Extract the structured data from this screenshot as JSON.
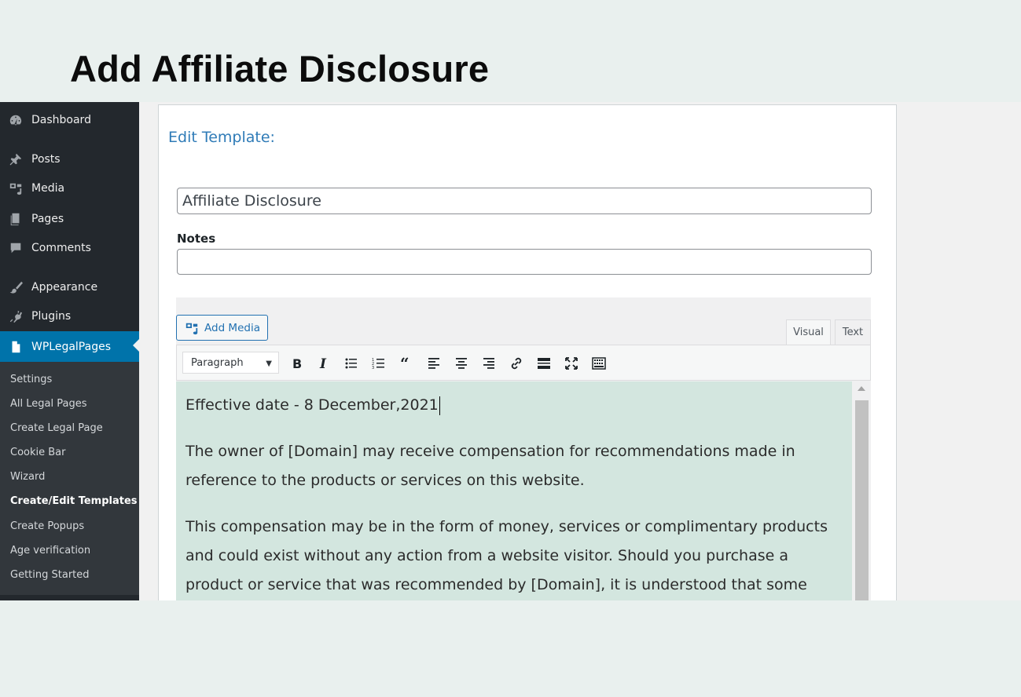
{
  "headline": "Add Affiliate Disclosure",
  "sidebar": {
    "items": [
      {
        "label": "Dashboard",
        "icon": "dashboard-icon"
      },
      {
        "label": "Posts",
        "icon": "pin-icon"
      },
      {
        "label": "Media",
        "icon": "media-icon"
      },
      {
        "label": "Pages",
        "icon": "pages-icon"
      },
      {
        "label": "Comments",
        "icon": "comments-icon"
      },
      {
        "label": "Appearance",
        "icon": "brush-icon"
      },
      {
        "label": "Plugins",
        "icon": "plug-icon"
      },
      {
        "label": "WPLegalPages",
        "icon": "document-icon"
      }
    ],
    "submenu": [
      "Settings",
      "All Legal Pages",
      "Create Legal Page",
      "Cookie Bar",
      "Wizard",
      "Create/Edit Templates",
      "Create Popups",
      "Age verification",
      "Getting Started"
    ],
    "current_submenu": "Create/Edit Templates"
  },
  "editor": {
    "heading": "Edit Template:",
    "title_value": "Affiliate Disclosure",
    "notes_label": "Notes",
    "notes_value": "",
    "add_media_label": "Add Media",
    "tab_visual": "Visual",
    "tab_text": "Text",
    "format_select": "Paragraph",
    "toolbar_icons": [
      "bold-icon",
      "italic-icon",
      "bullet-list-icon",
      "numbered-list-icon",
      "blockquote-icon",
      "align-left-icon",
      "align-center-icon",
      "align-right-icon",
      "link-icon",
      "read-more-icon",
      "fullscreen-icon",
      "toolbar-toggle-icon"
    ],
    "paragraphs": [
      "Effective date - 8 December,2021",
      "The owner of [Domain] may receive compensation for recommendations made in reference to the products or services on this website.",
      "This compensation may be in the form of money, services or complimentary products and could exist without any action from a website visitor. Should you purchase a product or service that was recommended by [Domain], it is understood that some"
    ]
  },
  "colors": {
    "page_background": "#e9f0ee",
    "sidebar": "#23282d",
    "sidebar_active": "#0073aa",
    "editor_content": "#d3e6df",
    "link_blue": "#2271b1"
  }
}
